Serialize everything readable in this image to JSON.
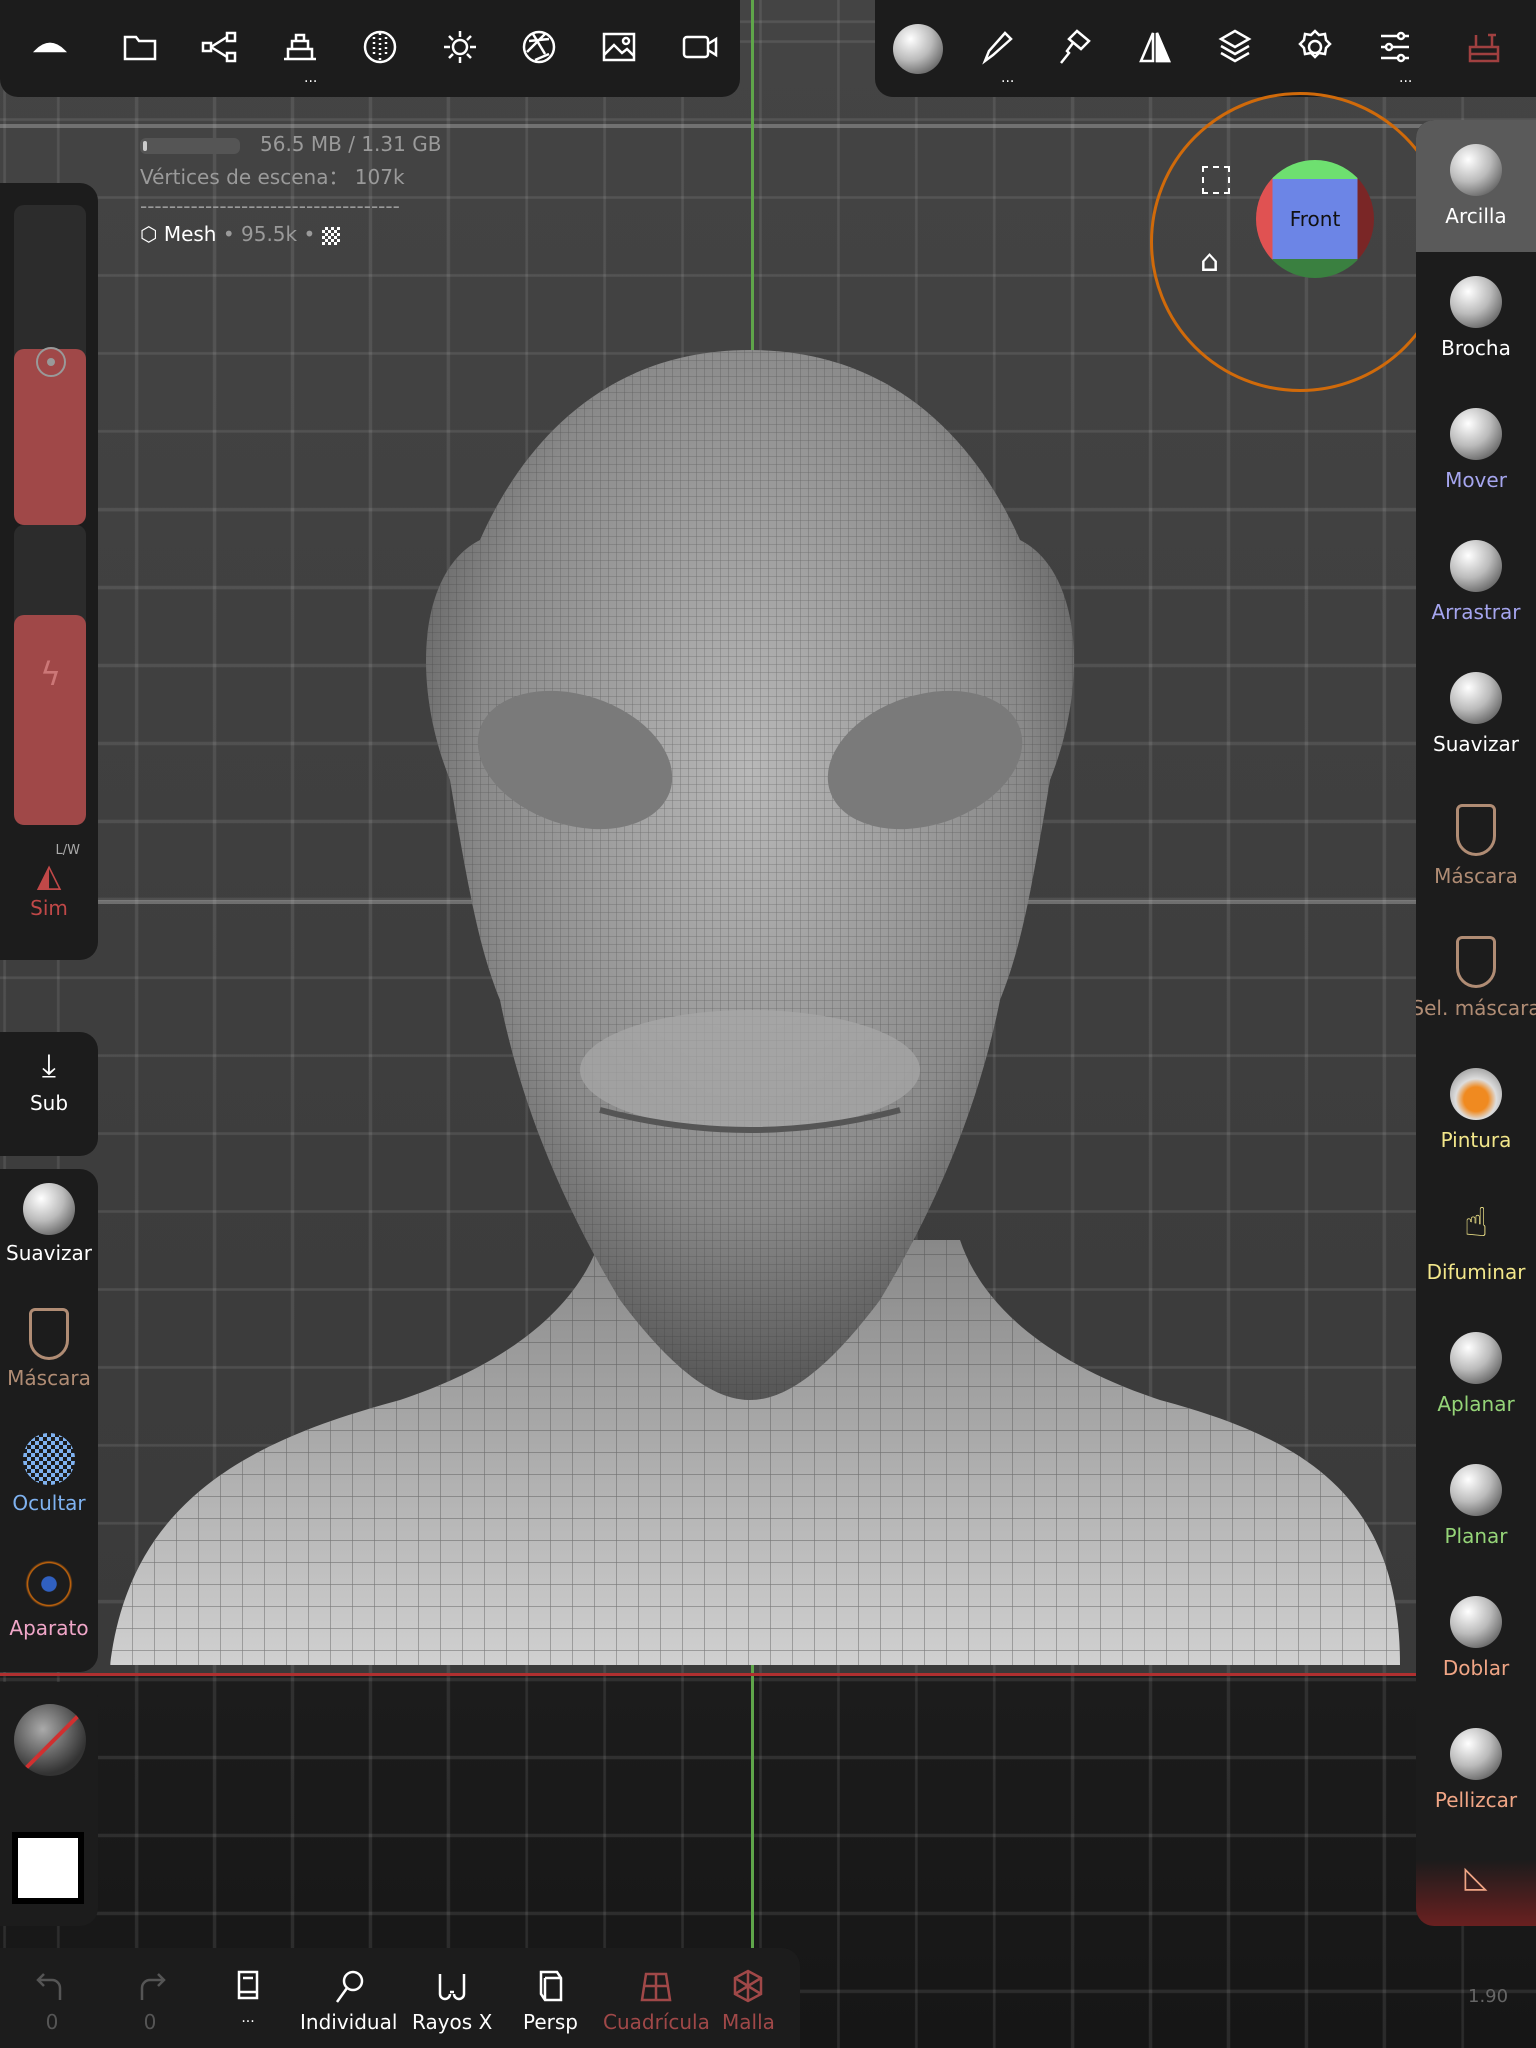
{
  "top_left_toolbar": [
    {
      "icon": "scene-icon"
    },
    {
      "icon": "folder-icon"
    },
    {
      "icon": "scene-graph-icon"
    },
    {
      "icon": "primitives-icon",
      "dots": "..."
    },
    {
      "icon": "material-sphere-icon"
    },
    {
      "icon": "light-icon"
    },
    {
      "icon": "camera-aperture-icon"
    },
    {
      "icon": "image-icon"
    },
    {
      "icon": "video-icon"
    }
  ],
  "top_right_toolbar": [
    {
      "icon": "brush-preview-icon"
    },
    {
      "icon": "paint-brush-icon",
      "dots": "..."
    },
    {
      "icon": "paint-roller-icon"
    },
    {
      "icon": "symmetry-icon"
    },
    {
      "icon": "layers-icon"
    },
    {
      "icon": "settings-gear-icon"
    },
    {
      "icon": "sliders-icon",
      "dots": "..."
    },
    {
      "icon": "toolbox-icon"
    }
  ],
  "info": {
    "memory": "56.5 MB / 1.31 GB",
    "memory_fraction": 0.043,
    "scene_vertices": "Vértices de escena： 107k",
    "separator": "------------------------------------",
    "mesh_name": "Mesh",
    "mesh_count": "• 95.5k •"
  },
  "gizmo": {
    "face": "Front"
  },
  "right_tools": [
    {
      "label": "Arcilla",
      "color": "#ffffff",
      "active": true
    },
    {
      "label": "Brocha",
      "color": "#ffffff"
    },
    {
      "label": "Mover",
      "color": "#a5a5ee"
    },
    {
      "label": "Arrastrar",
      "color": "#a5a5ee"
    },
    {
      "label": "Suavizar",
      "color": "#ffffff"
    },
    {
      "label": "Máscara",
      "color": "#b08c74"
    },
    {
      "label": "Sel. máscara",
      "color": "#b08c74"
    },
    {
      "label": "Pintura",
      "color": "#f2e68a"
    },
    {
      "label": "Difuminar",
      "color": "#f2e68a"
    },
    {
      "label": "Aplanar",
      "color": "#95d478"
    },
    {
      "label": "Planar",
      "color": "#95d478"
    },
    {
      "label": "Doblar",
      "color": "#f0a585"
    },
    {
      "label": "Pellizcar",
      "color": "#f0a585"
    }
  ],
  "left_panel": {
    "sym_label": "Sim",
    "sym_sub": "L/W",
    "radius_fraction": 0.55,
    "intensity_fraction": 0.7
  },
  "sub_label": "Sub",
  "left_tools": [
    {
      "label": "Suavizar",
      "color": "#ffffff"
    },
    {
      "label": "Máscara",
      "color": "#b08c74"
    },
    {
      "label": "Ocultar",
      "color": "#7fb2f0"
    },
    {
      "label": "Aparato",
      "color": "#f0a6c8"
    }
  ],
  "bottom_bar": {
    "undo_count": "0",
    "redo_count": "0",
    "menu_dots": "...",
    "individual": "Individual",
    "xray": "Rayos X",
    "persp": "Persp",
    "grid": "Cuadrícula",
    "wireframe": "Malla"
  },
  "fps": "1.90",
  "colors": {
    "accent_red": "#a04040",
    "gizmo_ring": "#d06a0a"
  }
}
